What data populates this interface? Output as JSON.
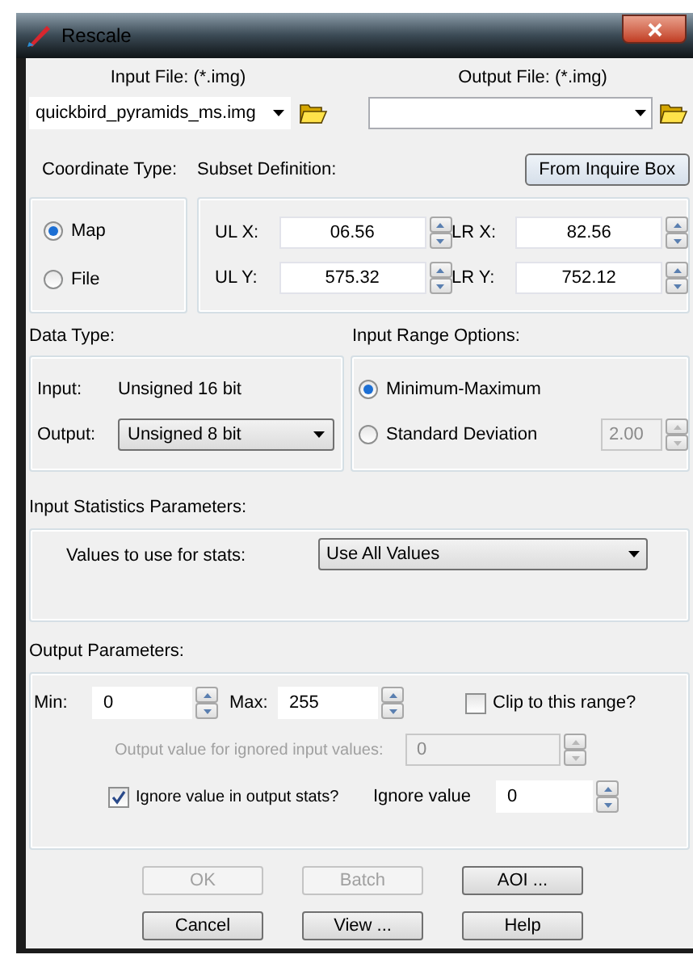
{
  "window": {
    "title": "Rescale"
  },
  "input_file": {
    "label": "Input File: (*.img)",
    "value": "quickbird_pyramids_ms.img"
  },
  "output_file": {
    "label": "Output File: (*.img)"
  },
  "coordinate_type": {
    "label": "Coordinate Type:",
    "options": [
      {
        "label": "Map",
        "selected": true
      },
      {
        "label": "File",
        "selected": false
      }
    ]
  },
  "subset": {
    "label": "Subset Definition:",
    "button": "From Inquire Box",
    "fields": [
      {
        "label": "UL X:",
        "value": "06.56"
      },
      {
        "label": "LR X:",
        "value": "82.56"
      },
      {
        "label": "UL Y:",
        "value": "575.32"
      },
      {
        "label": "LR Y:",
        "value": "752.12"
      }
    ]
  },
  "data_type": {
    "label": "Data Type:",
    "input_label": "Input:",
    "input_value": "Unsigned 16 bit",
    "output_label": "Output:",
    "output_value": "Unsigned 8 bit"
  },
  "input_range": {
    "label": "Input Range Options:",
    "options": [
      {
        "label": "Minimum-Maximum",
        "selected": true
      },
      {
        "label": "Standard Deviation",
        "selected": false
      }
    ],
    "std_value": "2.00",
    "std_disabled": true
  },
  "input_stats": {
    "label": "Input Statistics Parameters:",
    "field_label": "Values to use for stats:",
    "value": "Use All Values"
  },
  "output_params": {
    "label": "Output Parameters:",
    "min_label": "Min:",
    "min": "0",
    "max_label": "Max:",
    "max": "255",
    "clip": {
      "label": "Clip to this range?",
      "checked": false
    },
    "ignored_output": {
      "label": "Output value for ignored input values:",
      "value": "0",
      "disabled": true
    },
    "ignore_stats": {
      "label": "Ignore value in output stats?",
      "checked": true
    },
    "ignore_value": {
      "label": "Ignore value",
      "value": "0"
    }
  },
  "buttons": [
    {
      "label": "OK",
      "disabled": true
    },
    {
      "label": "Batch",
      "disabled": true
    },
    {
      "label": "AOI ...",
      "disabled": false
    },
    {
      "label": "Cancel",
      "disabled": false
    },
    {
      "label": "View ...",
      "disabled": false
    },
    {
      "label": "Help",
      "disabled": false
    }
  ]
}
